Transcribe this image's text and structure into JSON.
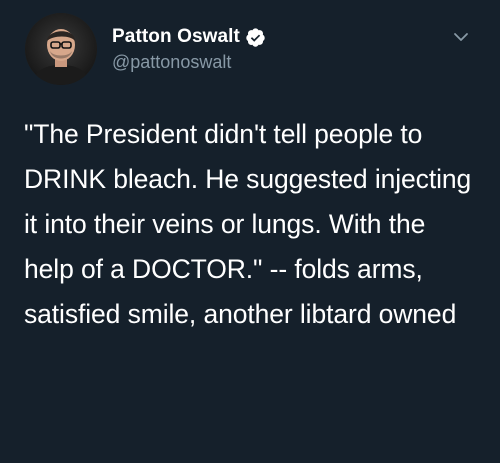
{
  "tweet": {
    "author": {
      "display_name": "Patton Oswalt",
      "handle": "@pattonoswalt",
      "verified": true,
      "avatar_icon": "profile-photo"
    },
    "text": "\"The President didn't tell people to DRINK bleach. He suggested injecting it into their veins or lungs. With the help of a DOCTOR.\" -- folds arms, satisfied smile, another libtard owned",
    "menu_icon": "chevron-down-icon"
  },
  "colors": {
    "background": "#15202b",
    "text": "#ffffff",
    "handle": "#8899a6",
    "verified_badge": "#ffffff"
  }
}
